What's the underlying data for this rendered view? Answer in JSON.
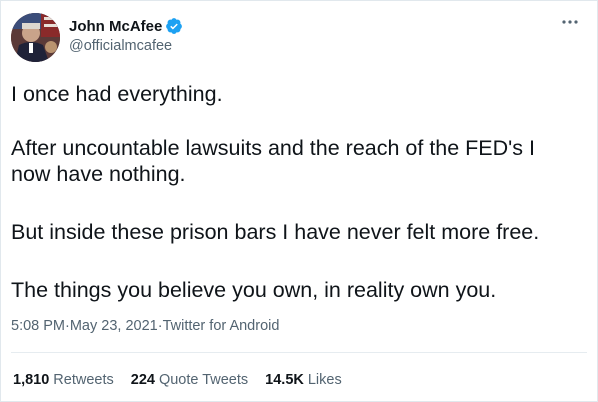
{
  "colors": {
    "text_primary": "#0f1419",
    "text_secondary": "#536471",
    "verified_blue": "#1da1f2",
    "divider": "#e6ecf0"
  },
  "author": {
    "display_name": "John McAfee",
    "handle": "@officialmcafee",
    "verified_icon": "verified-badge-icon",
    "avatar_icon": "profile-photo"
  },
  "menu": {
    "more_icon": "more-horizontal-icon"
  },
  "tweet": {
    "paragraphs": [
      "I once had everything.",
      "After uncountable lawsuits and the reach of the FED's I\nnow have nothing.",
      "But inside these prison bars I have never felt more free.",
      "The things you believe you own, in reality own you."
    ]
  },
  "meta": {
    "time": "5:08 PM",
    "separator": " · ",
    "date": "May 23, 2021",
    "source": "Twitter for Android"
  },
  "stats": {
    "retweets_count": "1,810",
    "retweets_label": "Retweets",
    "quotes_count": "224",
    "quotes_label": "Quote Tweets",
    "likes_count": "14.5K",
    "likes_label": "Likes"
  }
}
